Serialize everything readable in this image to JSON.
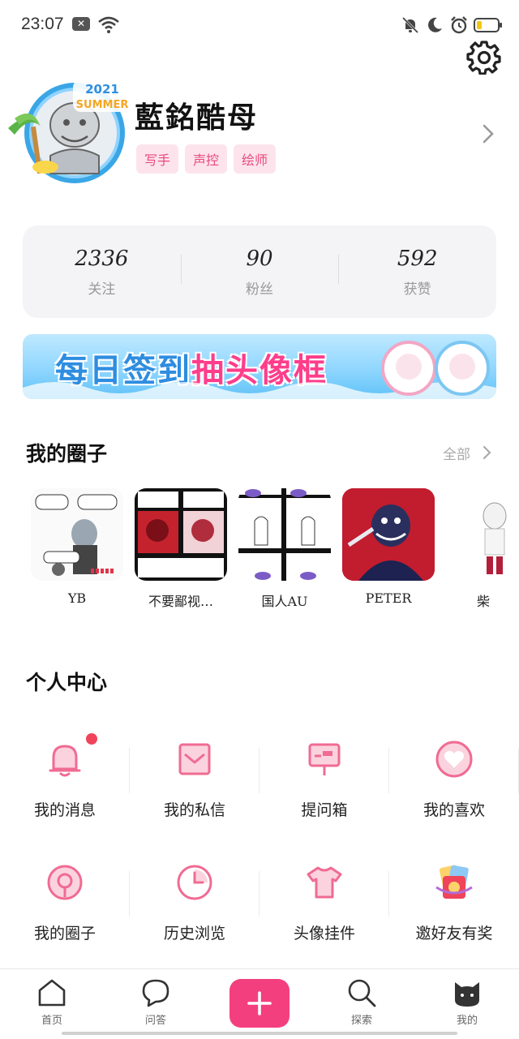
{
  "status_bar": {
    "time": "23:07"
  },
  "profile": {
    "avatar_frame_text": "2021 SUMMER",
    "username": "藍銘酷母",
    "tags": [
      "写手",
      "声控",
      "绘师"
    ]
  },
  "stats": [
    {
      "value": "2336",
      "label": "关注"
    },
    {
      "value": "90",
      "label": "粉丝"
    },
    {
      "value": "592",
      "label": "获赞"
    }
  ],
  "banner": {
    "text_part1": "每日签到",
    "text_part2": "抽头像框"
  },
  "circles_section": {
    "title": "我的圈子",
    "see_all": "全部",
    "items": [
      {
        "name": "YB"
      },
      {
        "name": "不要鄙视…"
      },
      {
        "name": "国人AU"
      },
      {
        "name": "PETER"
      },
      {
        "name": "柴"
      }
    ]
  },
  "personal_center": {
    "title": "个人中心",
    "items": [
      {
        "label": "我的消息",
        "icon": "bell-icon"
      },
      {
        "label": "我的私信",
        "icon": "envelope-icon"
      },
      {
        "label": "提问箱",
        "icon": "mailbox-icon"
      },
      {
        "label": "我的喜欢",
        "icon": "heart-icon"
      },
      {
        "label": "我的圈子",
        "icon": "circle-pin-icon"
      },
      {
        "label": "历史浏览",
        "icon": "clock-icon"
      },
      {
        "label": "头像挂件",
        "icon": "tshirt-icon"
      },
      {
        "label": "邀好友有奖",
        "icon": "gift-icon"
      }
    ]
  },
  "bottom_nav": {
    "items": [
      {
        "label": "首页",
        "icon": "home-icon"
      },
      {
        "label": "问答",
        "icon": "chat-icon"
      },
      {
        "label": "",
        "icon": "plus-icon"
      },
      {
        "label": "探索",
        "icon": "search-icon"
      },
      {
        "label": "我的",
        "icon": "cat-icon"
      }
    ]
  },
  "colors": {
    "accent": "#f43f7f",
    "icon_pink": "#f06b93",
    "tag_bg": "#fde4ec",
    "badge": "#f0445b"
  }
}
